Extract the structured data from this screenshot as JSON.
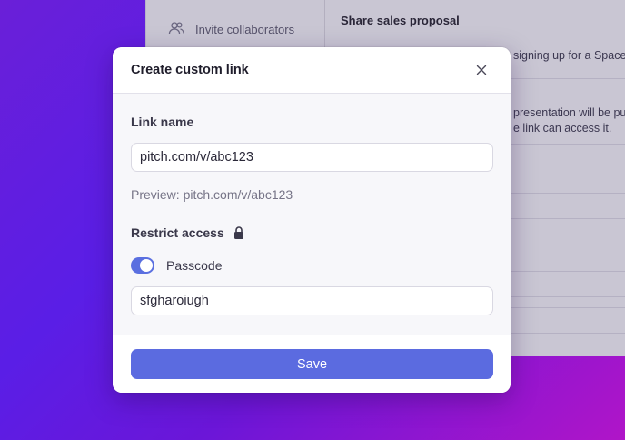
{
  "background": {
    "sidebar": {
      "invite_label": "Invite collaborators"
    },
    "main": {
      "title": "Share sales proposal",
      "fragment_1": "signing up for a Spacew",
      "fragment_2": "presentation will be pu",
      "fragment_3": "e link can access it."
    }
  },
  "dialog": {
    "title": "Create custom link",
    "link_name_label": "Link name",
    "link_name_value": "pitch.com/v/abc123",
    "preview_text": "Preview: pitch.com/v/abc123",
    "restrict_label": "Restrict access",
    "passcode_label": "Passcode",
    "passcode_enabled": true,
    "passcode_value": "sfgharoiugh",
    "save_label": "Save"
  },
  "colors": {
    "accent": "#5b6be0",
    "toggle_on": "#5a6fe0"
  },
  "icons": [
    "people-icon",
    "close-icon",
    "lock-icon"
  ]
}
